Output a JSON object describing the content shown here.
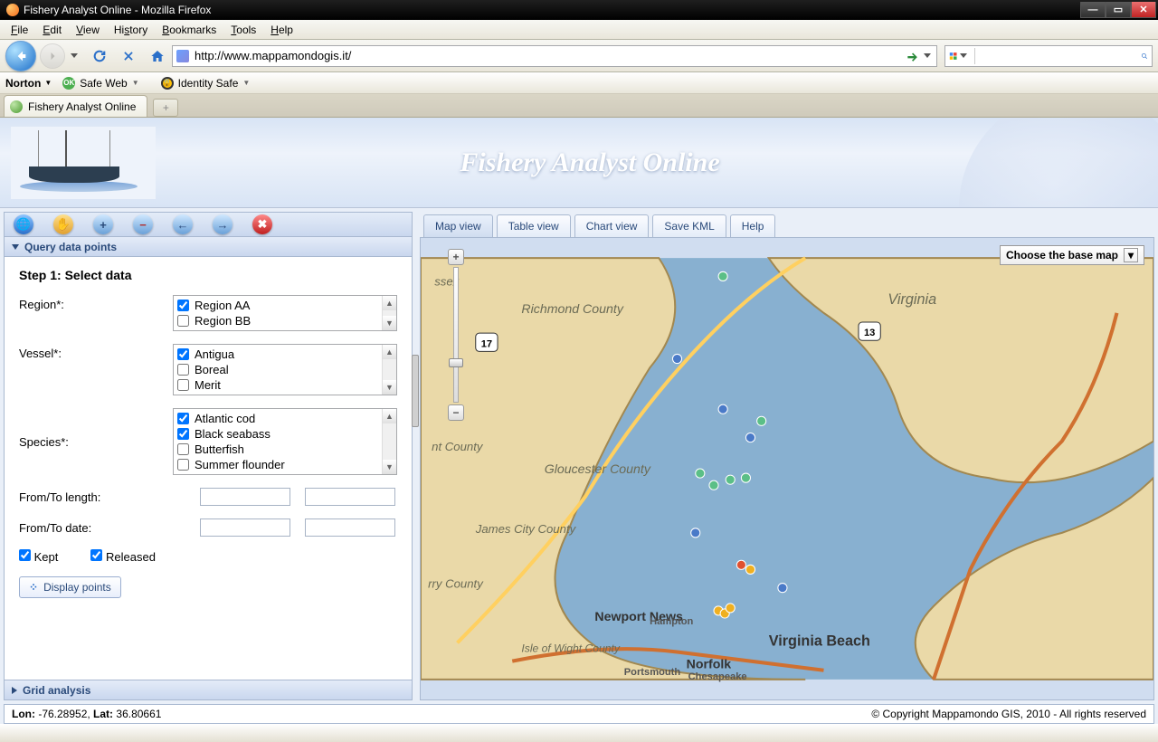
{
  "window": {
    "title": "Fishery Analyst Online - Mozilla Firefox"
  },
  "menubar": {
    "file": "File",
    "edit": "Edit",
    "view": "View",
    "history": "History",
    "bookmarks": "Bookmarks",
    "tools": "Tools",
    "help": "Help"
  },
  "url": "http://www.mappamondogis.it/",
  "norton": {
    "brand": "Norton",
    "safeweb": "Safe Web",
    "idsafe": "Identity Safe"
  },
  "browser_tab": "Fishery Analyst Online",
  "banner_title": "Fishery Analyst Online",
  "accordion": {
    "query": "Query data points",
    "grid": "Grid analysis"
  },
  "form": {
    "step_title": "Step 1: Select data",
    "region_label": "Region*:",
    "regions": [
      {
        "label": "Region AA",
        "checked": true
      },
      {
        "label": "Region BB",
        "checked": false
      }
    ],
    "vessel_label": "Vessel*:",
    "vessels": [
      {
        "label": "Antigua",
        "checked": true
      },
      {
        "label": "Boreal",
        "checked": false
      },
      {
        "label": "Merit",
        "checked": false
      }
    ],
    "species_label": "Species*:",
    "species": [
      {
        "label": "Atlantic cod",
        "checked": true
      },
      {
        "label": "Black seabass",
        "checked": true
      },
      {
        "label": "Butterfish",
        "checked": false
      },
      {
        "label": "Summer flounder",
        "checked": false
      }
    ],
    "length_label": "From/To length:",
    "date_label": "From/To date:",
    "kept_label": "Kept",
    "released_label": "Released",
    "display_btn": "Display points"
  },
  "tabs": {
    "map": "Map view",
    "table": "Table view",
    "chart": "Chart view",
    "kml": "Save KML",
    "help": "Help"
  },
  "basemap_btn": "Choose the base map",
  "map_labels": {
    "richmond": "Richmond County",
    "gloucester": "Gloucester County",
    "james": "James City County",
    "surry": "rry County",
    "wight": "Isle of Wight County",
    "newport": "Newport News",
    "hampton": "Hampton",
    "norfolk": "Norfolk",
    "portsmouth": "Portsmouth",
    "chesapeake": "Chesapeake",
    "vb": "Virginia Beach",
    "virginia": "Virginia",
    "kent": "nt County",
    "ssex": "ssex",
    "r17": "17",
    "r13": "13"
  },
  "status": {
    "lon_lbl": "Lon: ",
    "lon": "-76.28952, ",
    "lat_lbl": "Lat: ",
    "lat": "36.80661"
  },
  "copyright": "© Copyright Mappamondo GIS, 2010 - All rights reserved"
}
